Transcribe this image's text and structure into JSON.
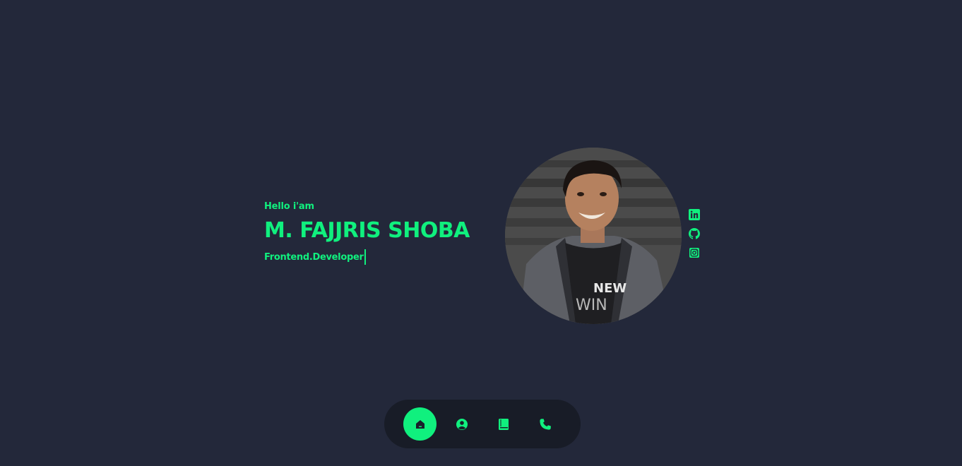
{
  "hero": {
    "greeting": "Hello i'am",
    "name": "M. FAJJRIS SHOBA",
    "role": "Frontend.Developer"
  },
  "avatar": {
    "shirt_text_1": "NEW",
    "shirt_text_2": "WIN"
  },
  "socials": [
    {
      "icon": "linkedin-icon"
    },
    {
      "icon": "github-icon"
    },
    {
      "icon": "instagram-icon"
    }
  ],
  "nav": {
    "items": [
      {
        "icon": "home-icon",
        "active": true
      },
      {
        "icon": "user-icon",
        "active": false
      },
      {
        "icon": "book-icon",
        "active": false
      },
      {
        "icon": "phone-icon",
        "active": false
      }
    ]
  },
  "colors": {
    "accent": "#10f07e",
    "background": "#23283a",
    "nav_background": "#181c27"
  }
}
